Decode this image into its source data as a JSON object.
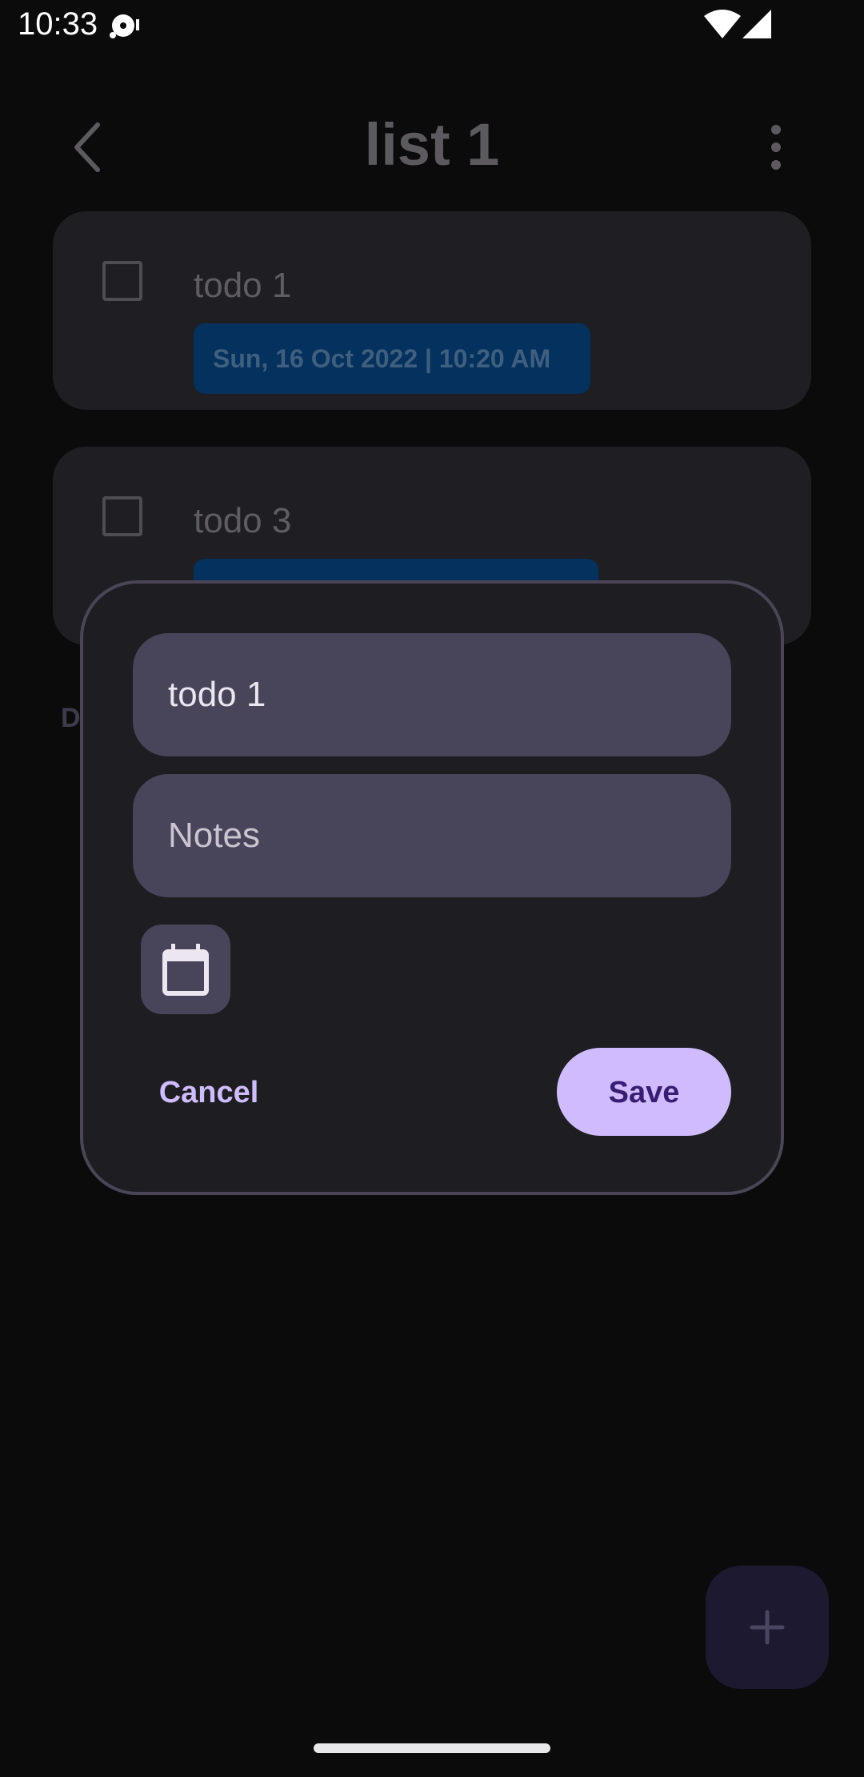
{
  "status_bar": {
    "time": "10:33"
  },
  "app_bar": {
    "title": "list 1"
  },
  "todos": [
    {
      "title": "todo 1",
      "date": "Sun, 16 Oct 2022 | 10:20 AM"
    },
    {
      "title": "todo 3",
      "date": ""
    }
  ],
  "section_label": "D",
  "dialog": {
    "title_value": "todo 1",
    "notes_placeholder": "Notes",
    "cancel_label": "Cancel",
    "save_label": "Save"
  },
  "colors": {
    "accent": "#cfbcff",
    "on_accent": "#381e72",
    "field_bg": "#48445a",
    "date_chip": "#05315e"
  }
}
